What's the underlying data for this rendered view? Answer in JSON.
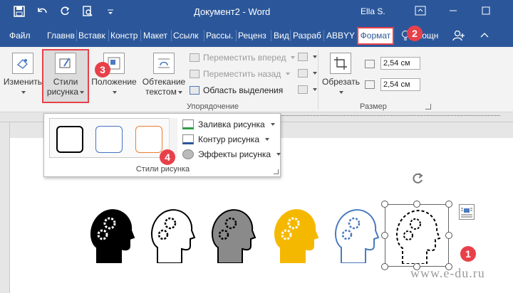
{
  "titlebar": {
    "title": "Документ2 - Word",
    "user": "Ella S.",
    "qat_icons": [
      "save-icon",
      "undo-icon",
      "redo-icon",
      "print-preview-icon",
      "customize-qat-icon"
    ],
    "window_icons": [
      "ribbon-display-icon",
      "minimize-icon",
      "maximize-icon",
      "close-icon"
    ]
  },
  "tabs": {
    "items": [
      "Файл",
      "Главнв",
      "Вставк",
      "Констр",
      "Макет",
      "Ссылк",
      "Рассы.",
      "Реценз",
      "Вид",
      "Разраб",
      "ABBYY"
    ],
    "active": "Формат",
    "help": "мощн",
    "help_icon": "lightbulb-icon",
    "share_icon": "share-person-icon"
  },
  "ribbon": {
    "change_label": "Изменить",
    "styles_label_1": "Стили",
    "styles_label_2": "рисунка",
    "position_label": "Положение",
    "wrap_label_1": "Обтекание",
    "wrap_label_2": "текстом",
    "bring_forward": "Переместить вперед",
    "send_backward": "Переместить назад",
    "selection_pane": "Область выделения",
    "arrange_group": "Упорядочение",
    "crop_label": "Обрезать",
    "height_value": "2,54 см",
    "width_value": "2,54 см",
    "size_group": "Размер"
  },
  "gallery": {
    "swatch_colors": [
      "#000000",
      "#4472c4",
      "#ed7d31"
    ],
    "fill": "Заливка рисунка",
    "outline": "Контур рисунка",
    "effects": "Эффекты рисунка",
    "group_label": "Стили рисунка"
  },
  "badges": [
    "1",
    "2",
    "3",
    "4"
  ],
  "heads": {
    "colors": [
      "#000000",
      "#ffffff",
      "#8a8a8a",
      "#f5b800",
      "#ffffff",
      "#ffffff"
    ],
    "outline_colors": [
      "#000000",
      "#000000",
      "#000000",
      "#f5b800",
      "#4a7bbf",
      "#000000"
    ]
  },
  "watermark": "www.e-du.ru"
}
